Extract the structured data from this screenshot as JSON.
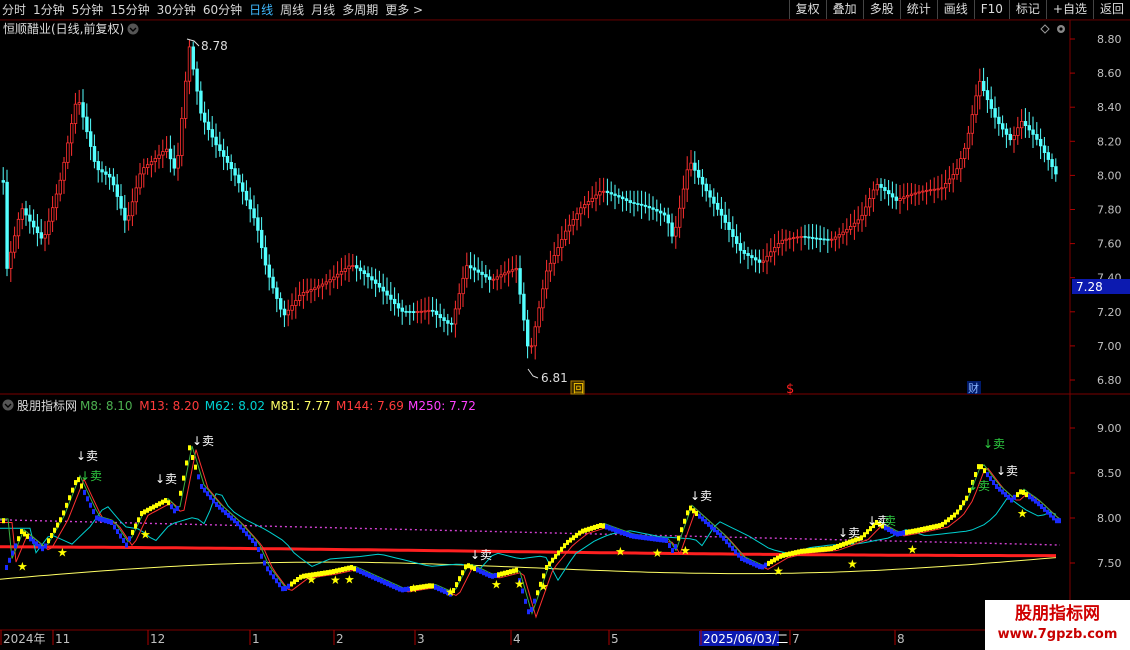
{
  "toolbar": {
    "periods": [
      "分时",
      "1分钟",
      "5分钟",
      "15分钟",
      "30分钟",
      "60分钟",
      "日线",
      "周线",
      "月线",
      "多周期",
      "更多 >"
    ],
    "active_period": "日线",
    "right_buttons": [
      "复权",
      "叠加",
      "多股",
      "统计",
      "画线",
      "F10",
      "标记",
      "+自选",
      "返回"
    ]
  },
  "price_panel": {
    "title": "恒顺醋业(日线,前复权)",
    "price_axis": [
      "8.80",
      "8.60",
      "8.40",
      "8.20",
      "8.00",
      "7.80",
      "7.60",
      "7.40",
      "7.20",
      "7.00",
      "6.80"
    ],
    "current_price": "7.28",
    "high_label": "8.78",
    "low_label": "6.81",
    "markers": [
      "回",
      "$",
      "财"
    ]
  },
  "indicator_panel": {
    "name": "股朋指标网",
    "ma_readouts": [
      {
        "label": "M8: 8.10",
        "color": "#4caf50"
      },
      {
        "label": "M13: 8.20",
        "color": "#ff3b3b"
      },
      {
        "label": "M62: 8.02",
        "color": "#00d0d0"
      },
      {
        "label": "M81: 7.77",
        "color": "#ffff66"
      },
      {
        "label": "M144: 7.69",
        "color": "#ff3b3b"
      },
      {
        "label": "M250: 7.72",
        "color": "#ff40ff"
      }
    ],
    "axis": [
      "9.00",
      "8.50",
      "8.00",
      "7.50"
    ],
    "sell_label": "卖",
    "sell_marker": "↓卖"
  },
  "time_axis": {
    "labels": [
      "2024年",
      "11",
      "12",
      "1",
      "2",
      "3",
      "4",
      "5",
      "2025/06/03/二",
      "7",
      "8"
    ]
  },
  "watermark": {
    "title": "股朋指标网",
    "url": "www.7gpzb.com"
  },
  "colors": {
    "up": "#ff3030",
    "down": "#54ffff",
    "bg": "#000000",
    "grid": "#5a0000",
    "axis_text": "#c0c0c0"
  }
}
